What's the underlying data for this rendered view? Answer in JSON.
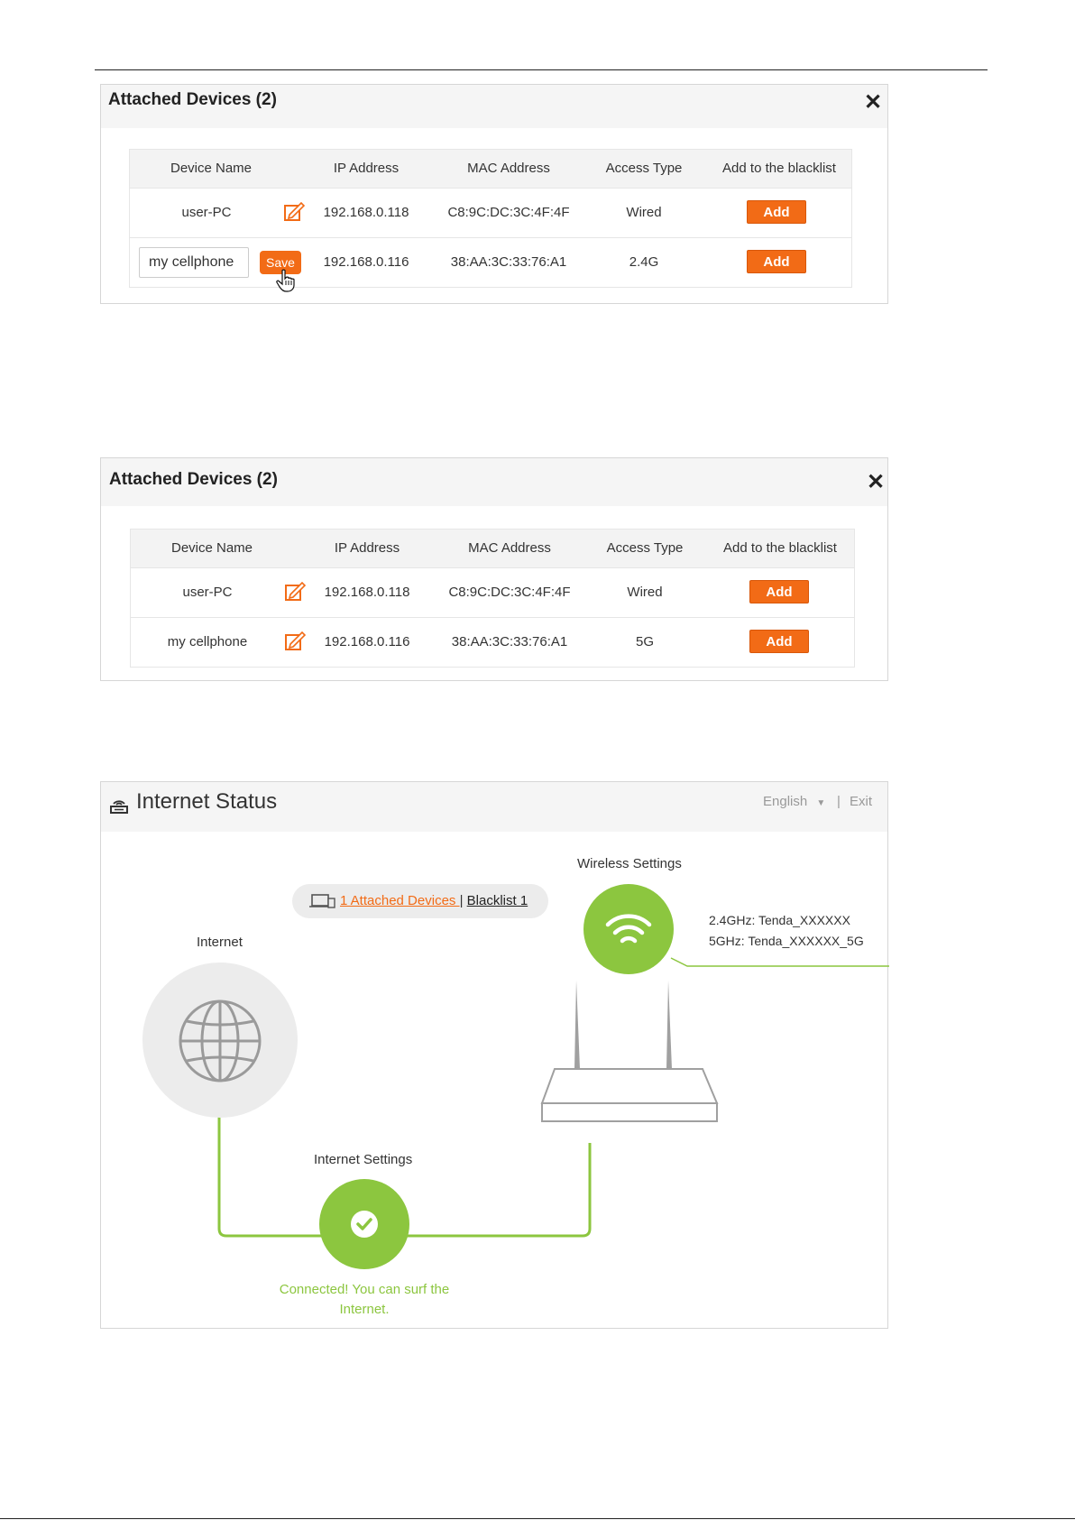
{
  "panel1": {
    "title": "Attached Devices (2)",
    "close": "✕",
    "headers": [
      "Device Name",
      "IP Address",
      "MAC Address",
      "Access Type",
      "Add to the blacklist"
    ],
    "rows": [
      {
        "name": "user-PC",
        "ip": "192.168.0.118",
        "mac": "C8:9C:DC:3C:4F:4F",
        "access": "Wired",
        "action": "Add"
      },
      {
        "name_input": "my cellphone",
        "save": "Save",
        "ip": "192.168.0.116",
        "mac": "38:AA:3C:33:76:A1",
        "access": "2.4G",
        "action": "Add"
      }
    ]
  },
  "panel2": {
    "title": "Attached Devices (2)",
    "close": "✕",
    "headers": [
      "Device Name",
      "IP Address",
      "MAC Address",
      "Access Type",
      "Add to the blacklist"
    ],
    "rows": [
      {
        "name": "user-PC",
        "ip": "192.168.0.118",
        "mac": "C8:9C:DC:3C:4F:4F",
        "access": "Wired",
        "action": "Add"
      },
      {
        "name": "my cellphone",
        "ip": "192.168.0.116",
        "mac": "38:AA:3C:33:76:A1",
        "access": "5G",
        "action": "Add"
      }
    ]
  },
  "status": {
    "title": "Internet Status",
    "language": "English",
    "separator": "|",
    "exit": "Exit",
    "attached_link": "1 Attached Devices ",
    "pill_separator": "|",
    "blacklist_link": "Blacklist 1",
    "internet_label": "Internet",
    "wireless_label": "Wireless Settings",
    "ssid_24": "2.4GHz: Tenda_XXXXXX",
    "ssid_5": "5GHz: Tenda_XXXXXX_5G",
    "internet_settings_label": "Internet Settings",
    "connected_line1": "Connected! You can surf the",
    "connected_line2": "Internet.",
    "colors": {
      "green": "#8cc63f",
      "orange": "#f26b16"
    }
  }
}
